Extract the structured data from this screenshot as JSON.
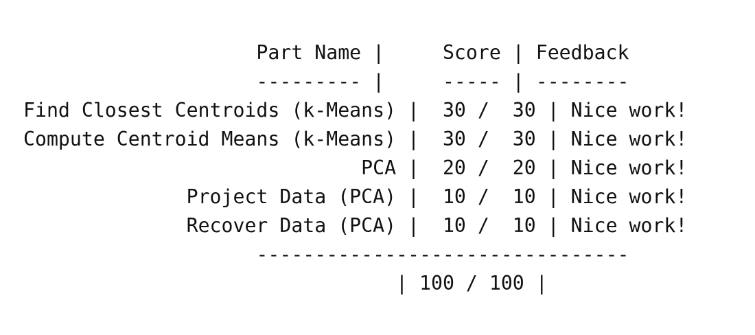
{
  "report": {
    "header": {
      "part": "Part Name",
      "score": "Score",
      "feedback": "Feedback"
    },
    "divider": {
      "part": "---------",
      "score": "-----",
      "feedback": "--------"
    },
    "rows": [
      {
        "part": "Find Closest Centroids (k-Means)",
        "earned": "30",
        "possible": "30",
        "feedback": "Nice work!"
      },
      {
        "part": "Compute Centroid Means (k-Means)",
        "earned": "30",
        "possible": "30",
        "feedback": "Nice work!"
      },
      {
        "part": "PCA",
        "earned": "20",
        "possible": "20",
        "feedback": "Nice work!"
      },
      {
        "part": "Project Data (PCA)",
        "earned": "10",
        "possible": "10",
        "feedback": "Nice work!"
      },
      {
        "part": "Recover Data (PCA)",
        "earned": "10",
        "possible": "10",
        "feedback": "Nice work!"
      }
    ],
    "footer_rule": "--------------------------------",
    "total": {
      "earned": "100",
      "possible": "100"
    }
  }
}
